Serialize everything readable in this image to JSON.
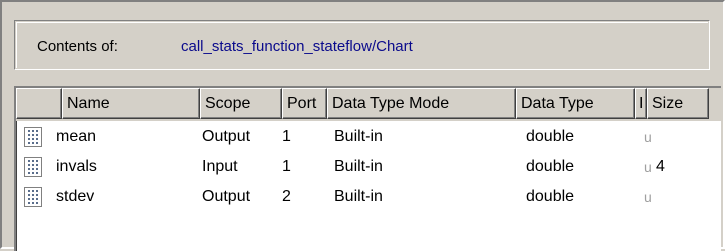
{
  "contents": {
    "label": "Contents of:",
    "path": "call_stats_function_stateflow/Chart"
  },
  "table": {
    "columns": [
      "",
      "Name",
      "Scope",
      "Port",
      "Data Type Mode",
      "Data Type",
      "I",
      "Size"
    ],
    "rows": [
      {
        "icon": "data-icon",
        "name": "mean",
        "scope": "Output",
        "port": "1",
        "mode": "Built-in",
        "type": "double",
        "i": "u",
        "size": ""
      },
      {
        "icon": "data-icon",
        "name": "invals",
        "scope": "Input",
        "port": "1",
        "mode": "Built-in",
        "type": "double",
        "i": "u",
        "size": "4"
      },
      {
        "icon": "data-icon",
        "name": "stdev",
        "scope": "Output",
        "port": "2",
        "mode": "Built-in",
        "type": "double",
        "i": "u",
        "size": ""
      }
    ]
  },
  "colors": {
    "path_text": "#0a0a8c",
    "chrome": "#d4d0c8",
    "icon_dots": "#5a6e8c"
  }
}
